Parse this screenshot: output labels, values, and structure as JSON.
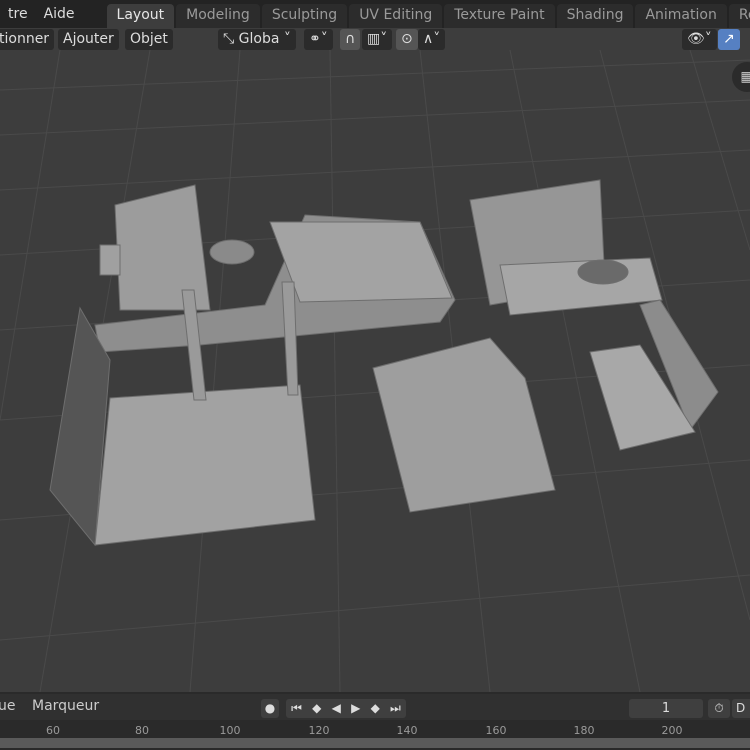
{
  "menus": [
    "tre",
    "Aide"
  ],
  "workspace_tabs": [
    {
      "label": "Layout",
      "active": true
    },
    {
      "label": "Modeling"
    },
    {
      "label": "Sculpting"
    },
    {
      "label": "UV Editing"
    },
    {
      "label": "Texture Paint"
    },
    {
      "label": "Shading"
    },
    {
      "label": "Animation"
    },
    {
      "label": "Rend"
    }
  ],
  "header_menus": [
    "tionner",
    "Ajouter",
    "Objet"
  ],
  "transform_orientation": "Globa",
  "timeline": {
    "menus": [
      "ue",
      "Marqueur"
    ],
    "current_frame": "1",
    "end_label": "D",
    "ruler_ticks": [
      "60",
      "80",
      "100",
      "120",
      "140",
      "160",
      "180",
      "200"
    ]
  },
  "colors": {
    "accent": "#5680c2",
    "viewport_bg": "#3d3d3d",
    "mesh": "#9a9a9a"
  }
}
